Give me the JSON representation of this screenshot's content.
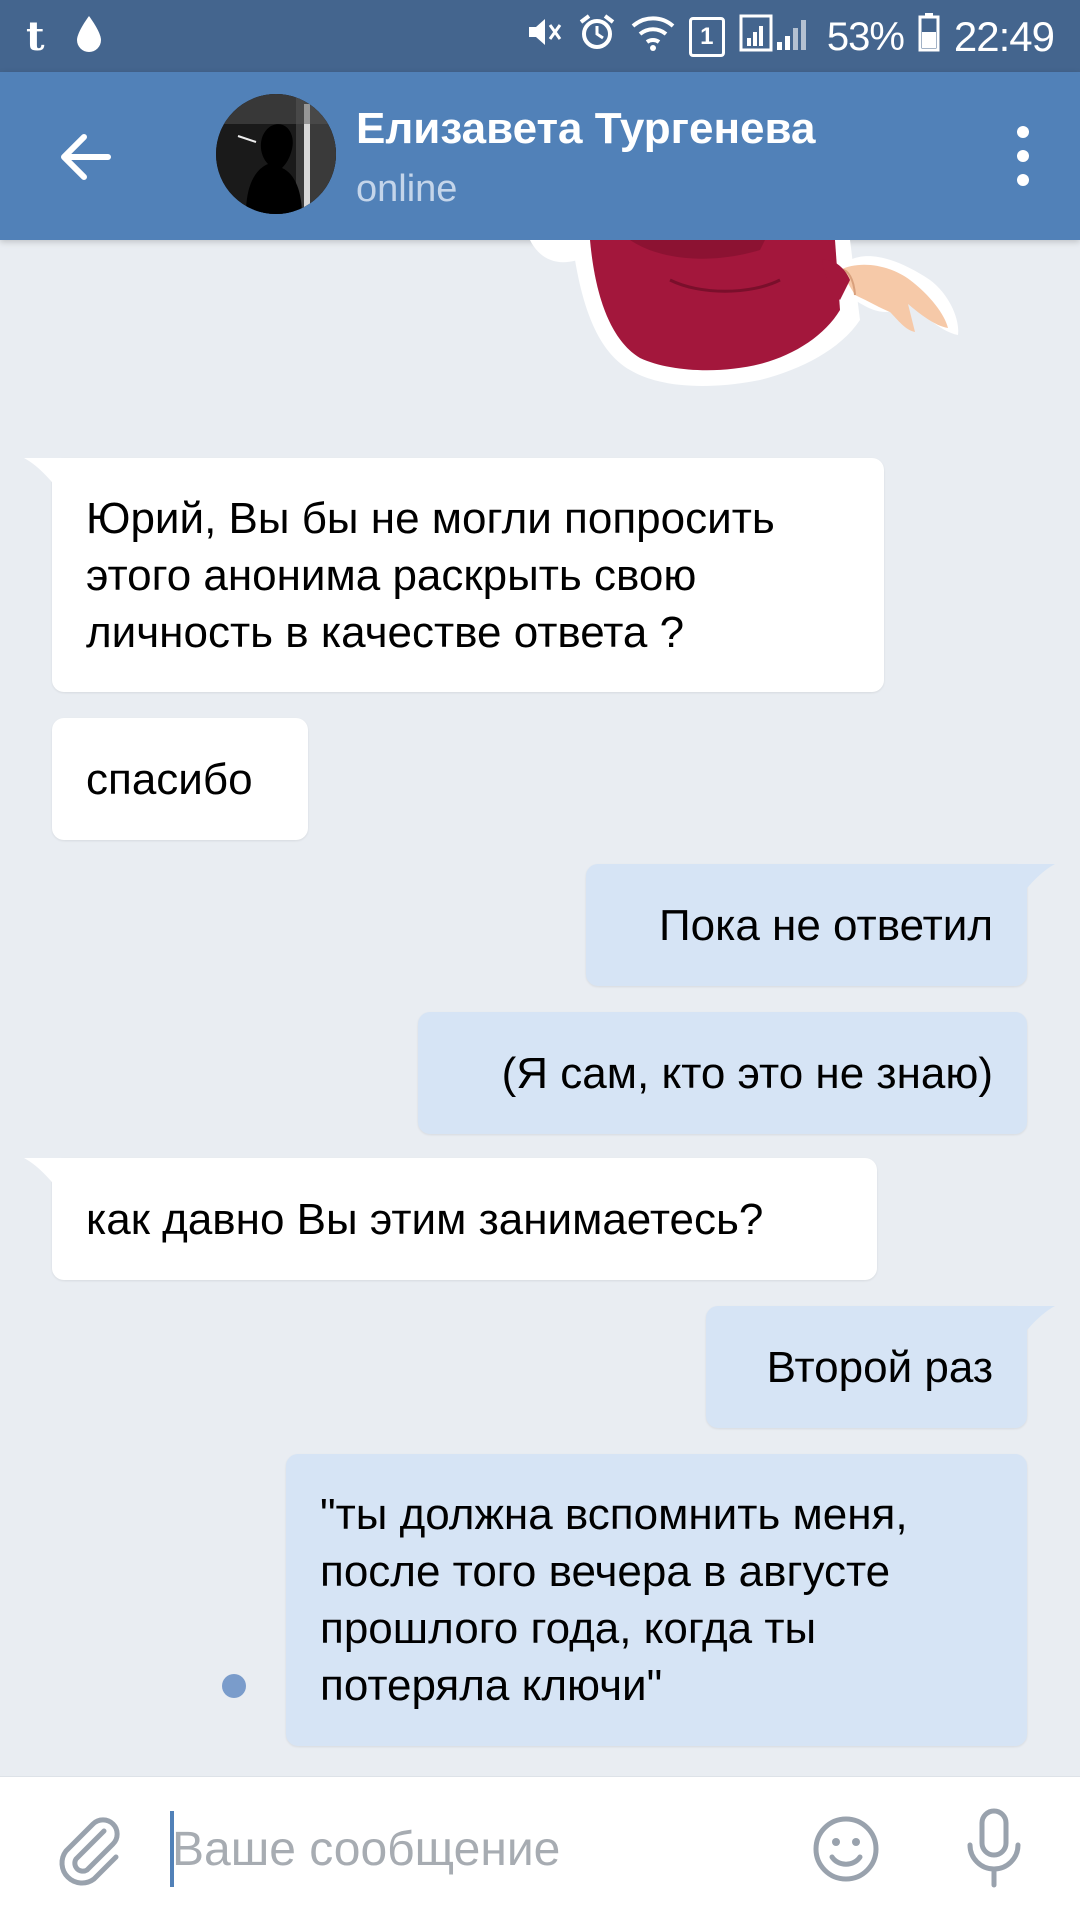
{
  "status_bar": {
    "sim_badge": "1",
    "battery": "53%",
    "time": "22:49",
    "icons": [
      "tumblr-icon",
      "drop-icon",
      "mute-icon",
      "alarm-icon",
      "wifi-icon",
      "signal-icon",
      "battery-icon"
    ]
  },
  "header": {
    "contact_name": "Елизавета Тургенева",
    "contact_status": "online"
  },
  "colors": {
    "header": "#5181b8",
    "status_bar": "#44658e",
    "incoming_bubble": "#ffffff",
    "outgoing_bubble": "#d6e4f5",
    "background": "#e9edf2",
    "accent": "#5181b8"
  },
  "messages": [
    {
      "direction": "in",
      "text": "Юрий, Вы бы не могли попросить этого анонима раскрыть свою личность в качестве ответа ?"
    },
    {
      "direction": "in",
      "text": "спасибо"
    },
    {
      "direction": "out",
      "text": "Пока не ответил"
    },
    {
      "direction": "out",
      "text": "(Я сам, кто это не знаю)"
    },
    {
      "direction": "in",
      "text": "как давно Вы этим занимаетесь?"
    },
    {
      "direction": "out",
      "text": "Второй раз"
    },
    {
      "direction": "out",
      "text": "\"ты должна вспомнить меня, после того вечера в августе прошлого года, когда ты потеряла ключи\"",
      "unread": true
    }
  ],
  "input": {
    "placeholder": "Ваше сообщение"
  }
}
